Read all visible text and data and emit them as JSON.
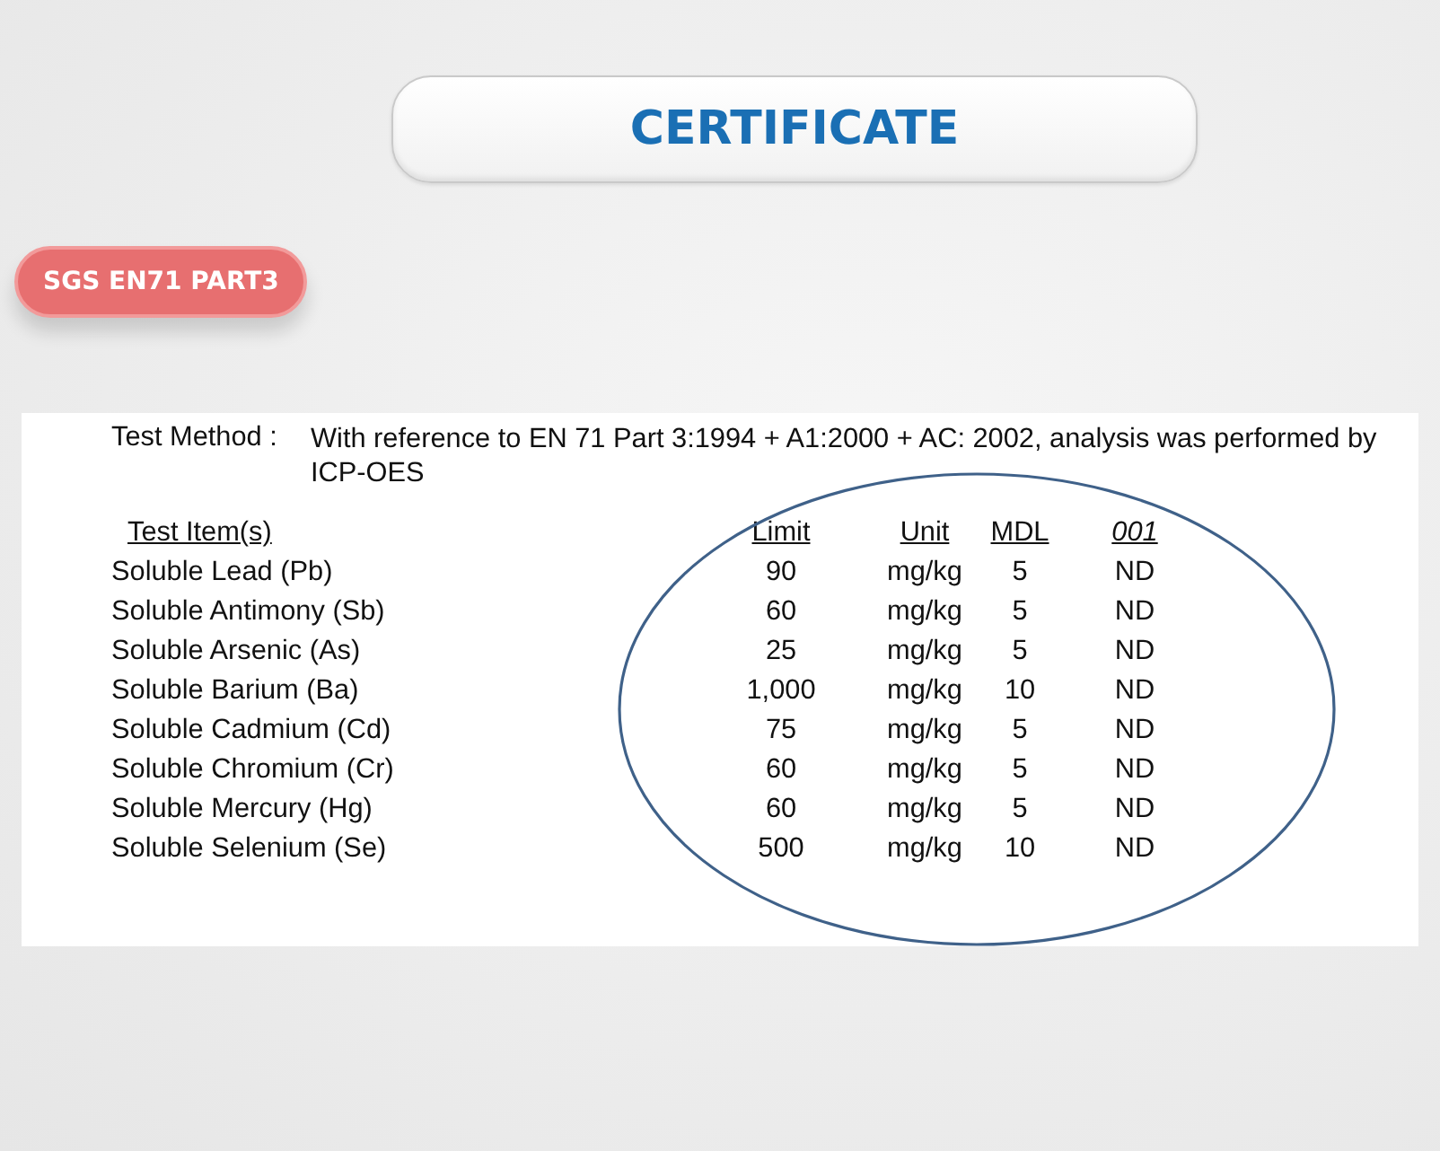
{
  "title": "CERTIFICATE",
  "badge": "SGS EN71 PART3",
  "document": {
    "method_label": "Test Method :",
    "method_text": "With reference to EN 71 Part 3:1994 + A1:2000 + AC: 2002, analysis was performed by ICP-OES",
    "columns": [
      {
        "label": "Test Item(s)",
        "italic": false
      },
      {
        "label": "Limit",
        "italic": false
      },
      {
        "label": "Unit",
        "italic": false
      },
      {
        "label": "MDL",
        "italic": false
      },
      {
        "label": "001",
        "italic": true
      }
    ],
    "rows": [
      [
        "Soluble Lead (Pb)",
        "90",
        "mg/kg",
        "5",
        "ND"
      ],
      [
        "Soluble Antimony (Sb)",
        "60",
        "mg/kg",
        "5",
        "ND"
      ],
      [
        "Soluble Arsenic (As)",
        "25",
        "mg/kg",
        "5",
        "ND"
      ],
      [
        "Soluble Barium (Ba)",
        "1,000",
        "mg/kg",
        "10",
        "ND"
      ],
      [
        "Soluble Cadmium (Cd)",
        "75",
        "mg/kg",
        "5",
        "ND"
      ],
      [
        "Soluble Chromium (Cr)",
        "60",
        "mg/kg",
        "5",
        "ND"
      ],
      [
        "Soluble Mercury (Hg)",
        "60",
        "mg/kg",
        "5",
        "ND"
      ],
      [
        "Soluble Selenium (Se)",
        "500",
        "mg/kg",
        "10",
        "ND"
      ]
    ]
  }
}
